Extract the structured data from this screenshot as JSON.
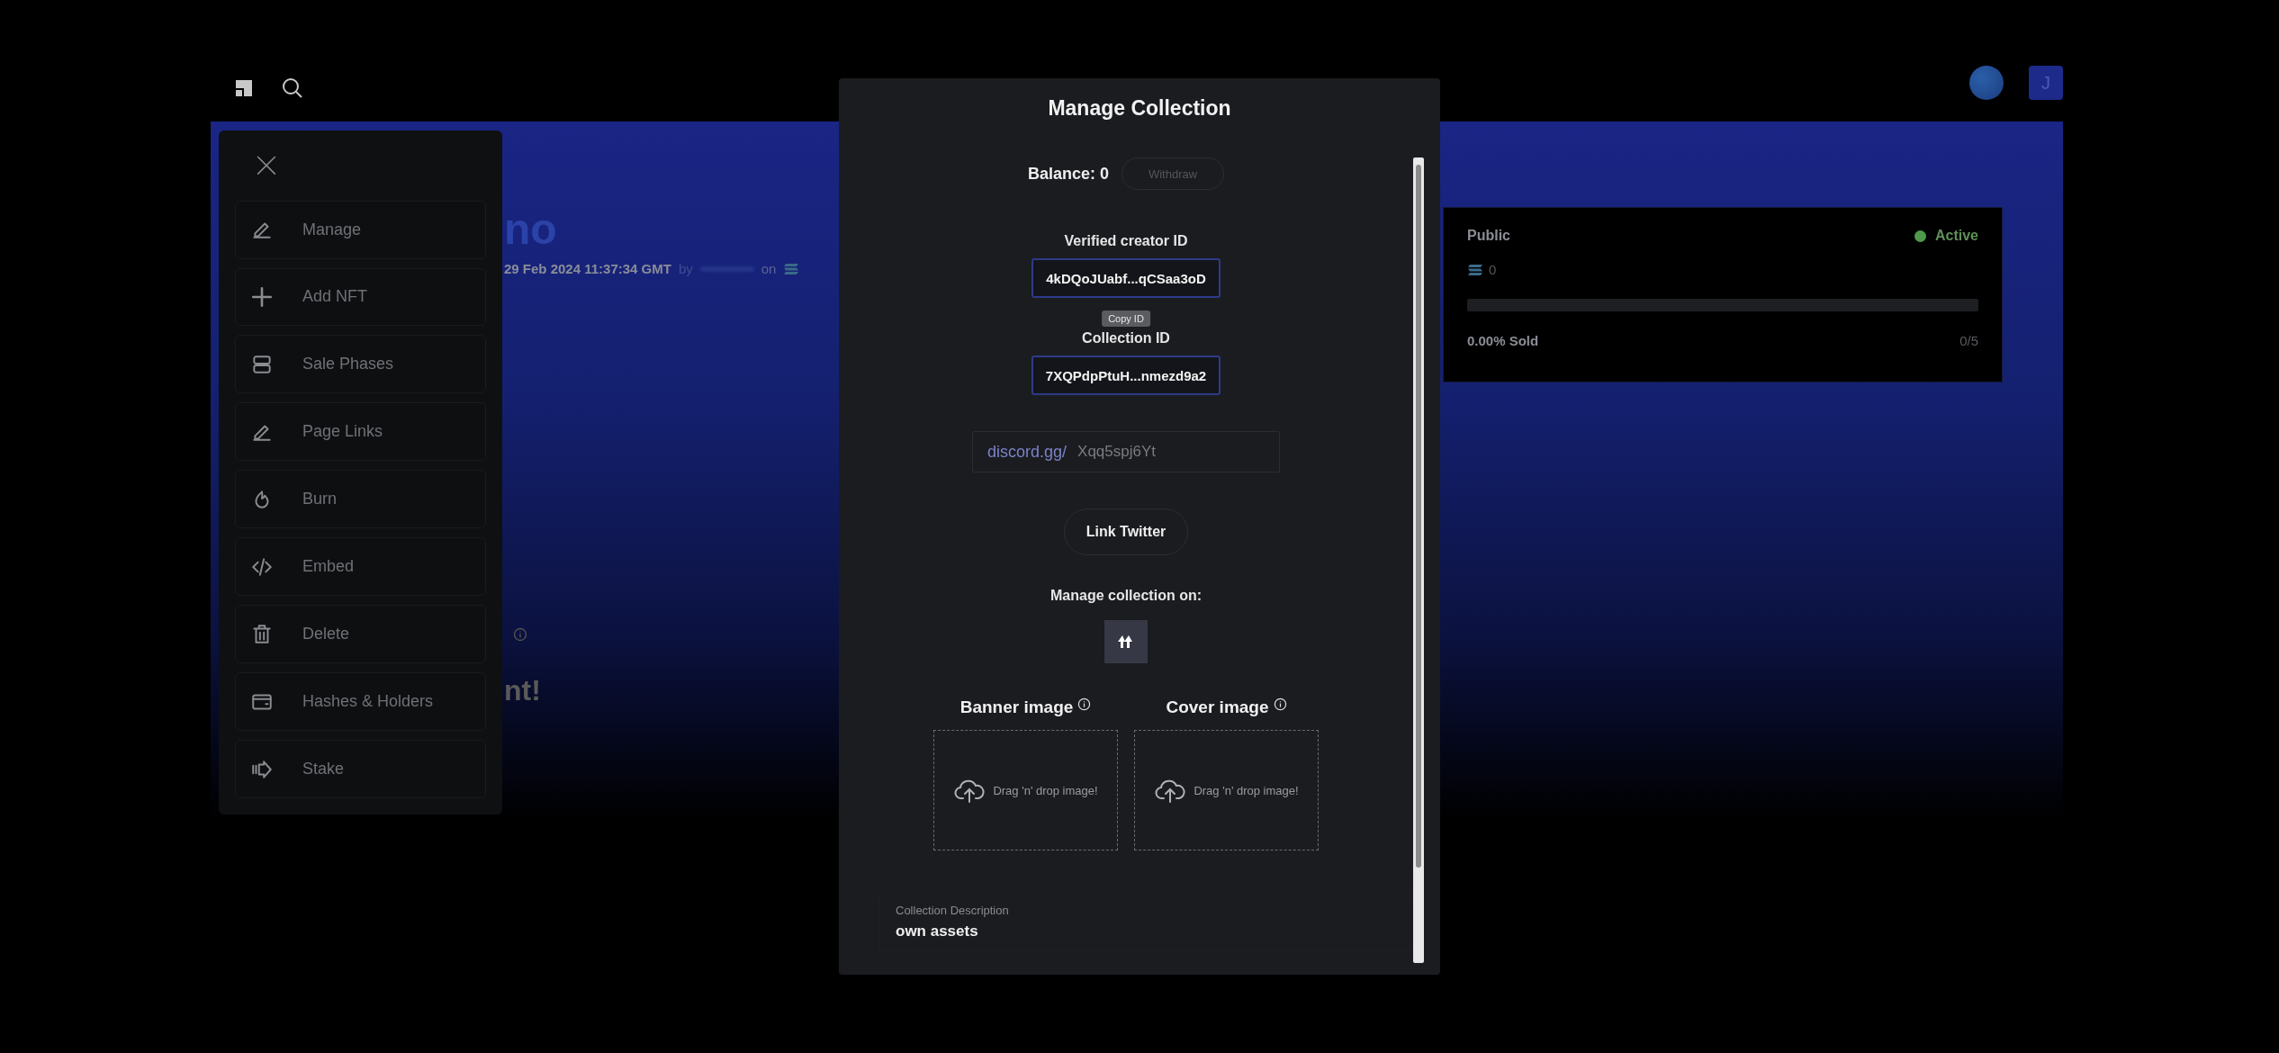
{
  "top_bar": {
    "avatar_initial": "J"
  },
  "background": {
    "title_fragment": "no",
    "date": "29 Feb 2024 11:37:34 GMT",
    "by": "by",
    "on": "on",
    "heading_fragment": "nt!"
  },
  "sale_card": {
    "phase": "Public",
    "status": {
      "label": "Active",
      "color": "#4e9a4a"
    },
    "price": "0",
    "level": 0,
    "sold": "0.00% Sold",
    "count": "0/5"
  },
  "side_menu": {
    "items": [
      {
        "label": "Manage"
      },
      {
        "label": "Add NFT"
      },
      {
        "label": "Sale Phases"
      },
      {
        "label": "Page Links"
      },
      {
        "label": "Burn"
      },
      {
        "label": "Embed"
      },
      {
        "label": "Delete"
      },
      {
        "label": "Hashes & Holders"
      },
      {
        "label": "Stake"
      }
    ]
  },
  "modal": {
    "title": "Manage Collection",
    "balance": "Balance: 0",
    "withdraw": {
      "label": "Withdraw",
      "disabled": true
    },
    "fields": [
      {
        "label": "Verified creator ID",
        "value": "4kDQoJUabf...qCSaa3oD"
      },
      {
        "label": "Collection ID",
        "value": "7XQPdpPtuH...nmezd9a2"
      }
    ],
    "tooltip": "Copy ID",
    "discord": {
      "prefix": "discord.gg/",
      "placeholder": "Xqq5spj6Yt"
    },
    "twitter_button": "Link Twitter",
    "manage_on": "Manage collection on:",
    "images": [
      {
        "label": "Banner image",
        "hint": "Drag 'n' drop image!"
      },
      {
        "label": "Cover image",
        "hint": "Drag 'n' drop image!"
      }
    ],
    "description": {
      "label": "Collection Description",
      "value": "own assets"
    }
  }
}
